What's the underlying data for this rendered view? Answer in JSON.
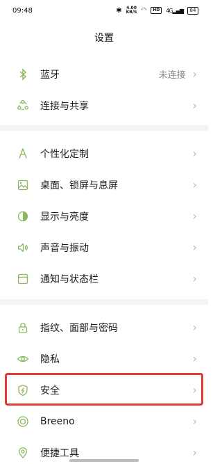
{
  "status": {
    "time": "09:48",
    "speed_value": "4.00",
    "speed_unit": "KB/S",
    "hd": "HD",
    "net": "4G",
    "battery": "84"
  },
  "header": {
    "title": "设置"
  },
  "groups": [
    {
      "items": [
        {
          "label": "蓝牙",
          "value": "未连接",
          "icon": "bluetooth-icon"
        },
        {
          "label": "连接与共享",
          "icon": "share-icon"
        }
      ]
    },
    {
      "items": [
        {
          "label": "个性化定制",
          "icon": "brush-icon"
        },
        {
          "label": "桌面、锁屏与息屏",
          "icon": "wallpaper-icon"
        },
        {
          "label": "显示与亮度",
          "icon": "brightness-icon"
        },
        {
          "label": "声音与振动",
          "icon": "speaker-icon"
        },
        {
          "label": "通知与状态栏",
          "icon": "notification-icon"
        }
      ]
    },
    {
      "items": [
        {
          "label": "指纹、面部与密码",
          "icon": "lock-icon"
        },
        {
          "label": "隐私",
          "icon": "privacy-eye-icon"
        },
        {
          "label": "安全",
          "icon": "shield-icon"
        },
        {
          "label": "Breeno",
          "icon": "breeno-icon"
        },
        {
          "label": "便捷工具",
          "icon": "tools-icon"
        }
      ]
    }
  ],
  "colors": {
    "icon": "#8bb85c",
    "highlight": "#e53935"
  }
}
